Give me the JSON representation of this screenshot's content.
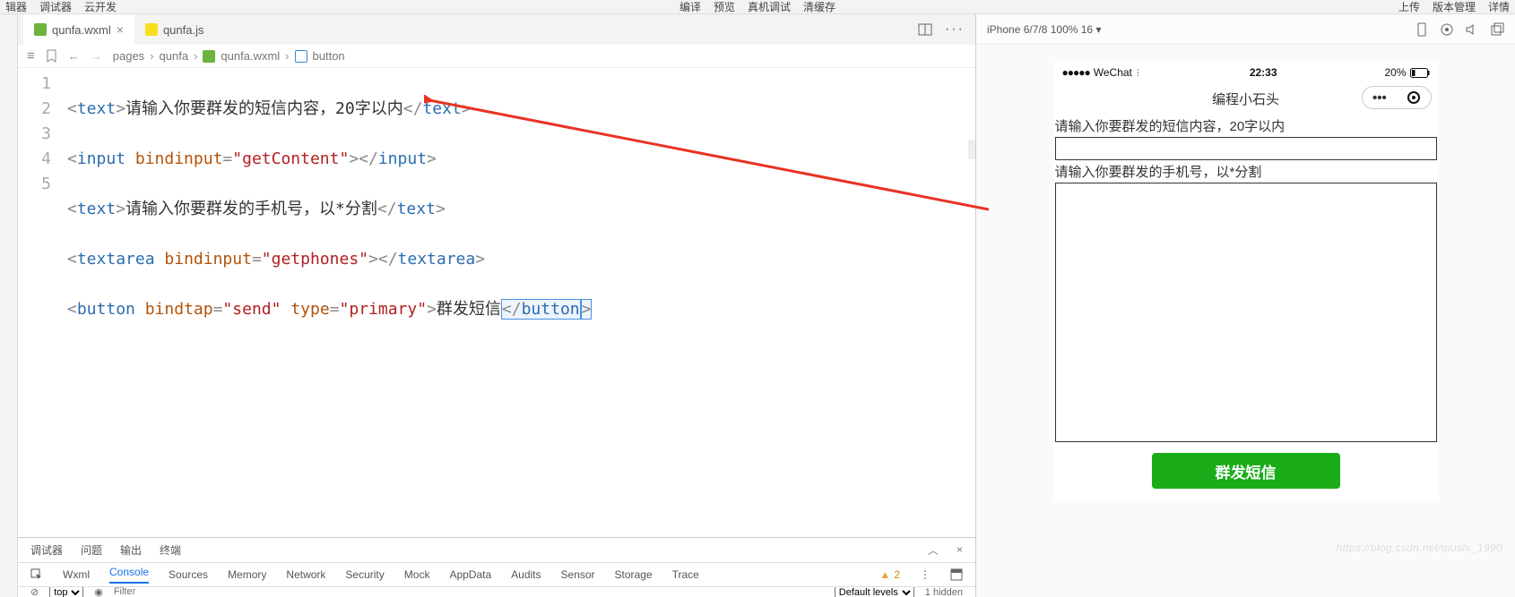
{
  "topmenu": {
    "left": [
      "辑器",
      "调试器",
      "云开发"
    ],
    "center": [
      "编译",
      "预览",
      "真机调试",
      "清缓存"
    ],
    "right": [
      "上传",
      "版本管理",
      "详情"
    ]
  },
  "tabs": {
    "active": "qunfa.wxml",
    "inactive": "qunfa.js"
  },
  "breadcrumb": {
    "a": "pages",
    "b": "qunfa",
    "c": "qunfa.wxml",
    "d": "button"
  },
  "gutter": [
    "1",
    "2",
    "3",
    "4",
    "5"
  ],
  "code": {
    "l1_text": "请输入你要群发的短信内容，20字以内",
    "l1_tag": "text",
    "l2_tag": "input",
    "l2_attr": "bindinput",
    "l2_val": "getContent",
    "l3_text": "请输入你要群发的手机号，以*分割",
    "l3_tag": "text",
    "l4_tag": "textarea",
    "l4_attr": "bindinput",
    "l4_val": "getphones",
    "l5_tag": "button",
    "l5_attr1": "bindtap",
    "l5_val1": "send",
    "l5_attr2": "type",
    "l5_val2": "primary",
    "l5_text": "群发短信"
  },
  "devtools": {
    "row1": [
      "调试器",
      "问题",
      "输出",
      "终端"
    ],
    "row2": [
      "Wxml",
      "Console",
      "Sources",
      "Memory",
      "Network",
      "Security",
      "Mock",
      "AppData",
      "Audits",
      "Sensor",
      "Storage",
      "Trace"
    ],
    "active": "Console",
    "warn": "2",
    "row3": {
      "top": "top",
      "filter": "Filter",
      "level": "Default levels",
      "hidden": "1 hidden"
    }
  },
  "preview": {
    "device": "iPhone 6/7/8 100% 16",
    "status": {
      "carrier": "WeChat",
      "time": "22:33",
      "battery": "20%"
    },
    "title": "编程小石头",
    "label1": "请输入你要群发的短信内容，20字以内",
    "label2": "请输入你要群发的手机号，以*分割",
    "button": "群发短信"
  },
  "watermark": "https://blog.csdn.net/qiushi_1990"
}
